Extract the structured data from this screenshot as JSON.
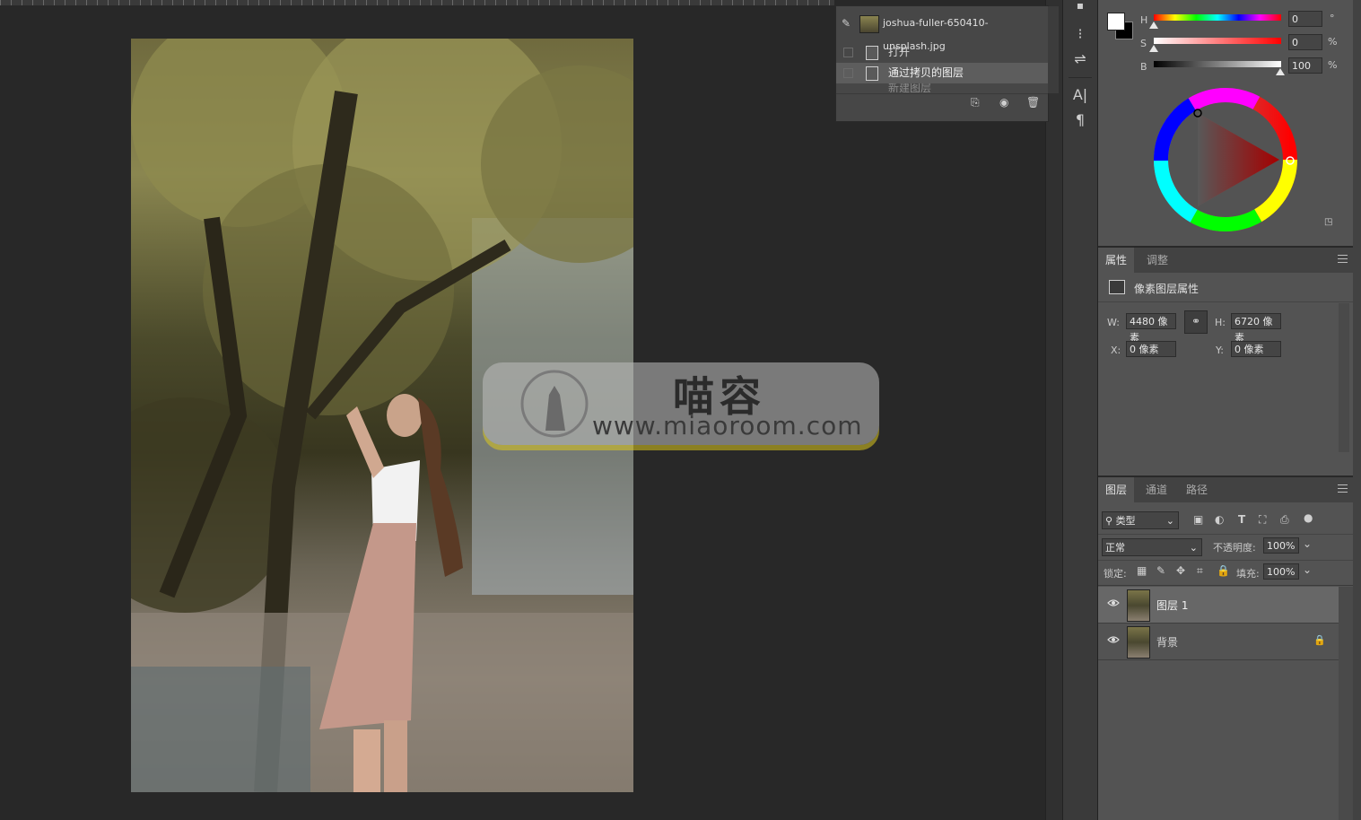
{
  "history": {
    "snapshot_name": "joshua-fuller-650410-unsplash.jpg",
    "items": [
      "打开",
      "通过拷贝的图层",
      "新建图层"
    ]
  },
  "color": {
    "h_label": "H",
    "h_value": "0",
    "h_unit": "°",
    "s_label": "S",
    "s_value": "0",
    "s_unit": "%",
    "b_label": "B",
    "b_value": "100",
    "b_unit": "%"
  },
  "properties": {
    "tabs": [
      "属性",
      "调整"
    ],
    "header": "像素图层属性",
    "w_label": "W:",
    "w_value": "4480 像素",
    "h_label": "H:",
    "h_value": "6720 像素",
    "x_label": "X:",
    "x_value": "0 像素",
    "y_label": "Y:",
    "y_value": "0 像素"
  },
  "layers": {
    "tabs": [
      "图层",
      "通道",
      "路径"
    ],
    "filter": "类型",
    "blend_mode": "正常",
    "opacity_label": "不透明度:",
    "opacity_value": "100%",
    "lock_label": "锁定:",
    "fill_label": "填充:",
    "fill_value": "100%",
    "items": [
      {
        "name": "图层 1"
      },
      {
        "name": "背景"
      }
    ]
  },
  "watermark": {
    "title": "喵容",
    "url": "www.miaoroom.com"
  }
}
